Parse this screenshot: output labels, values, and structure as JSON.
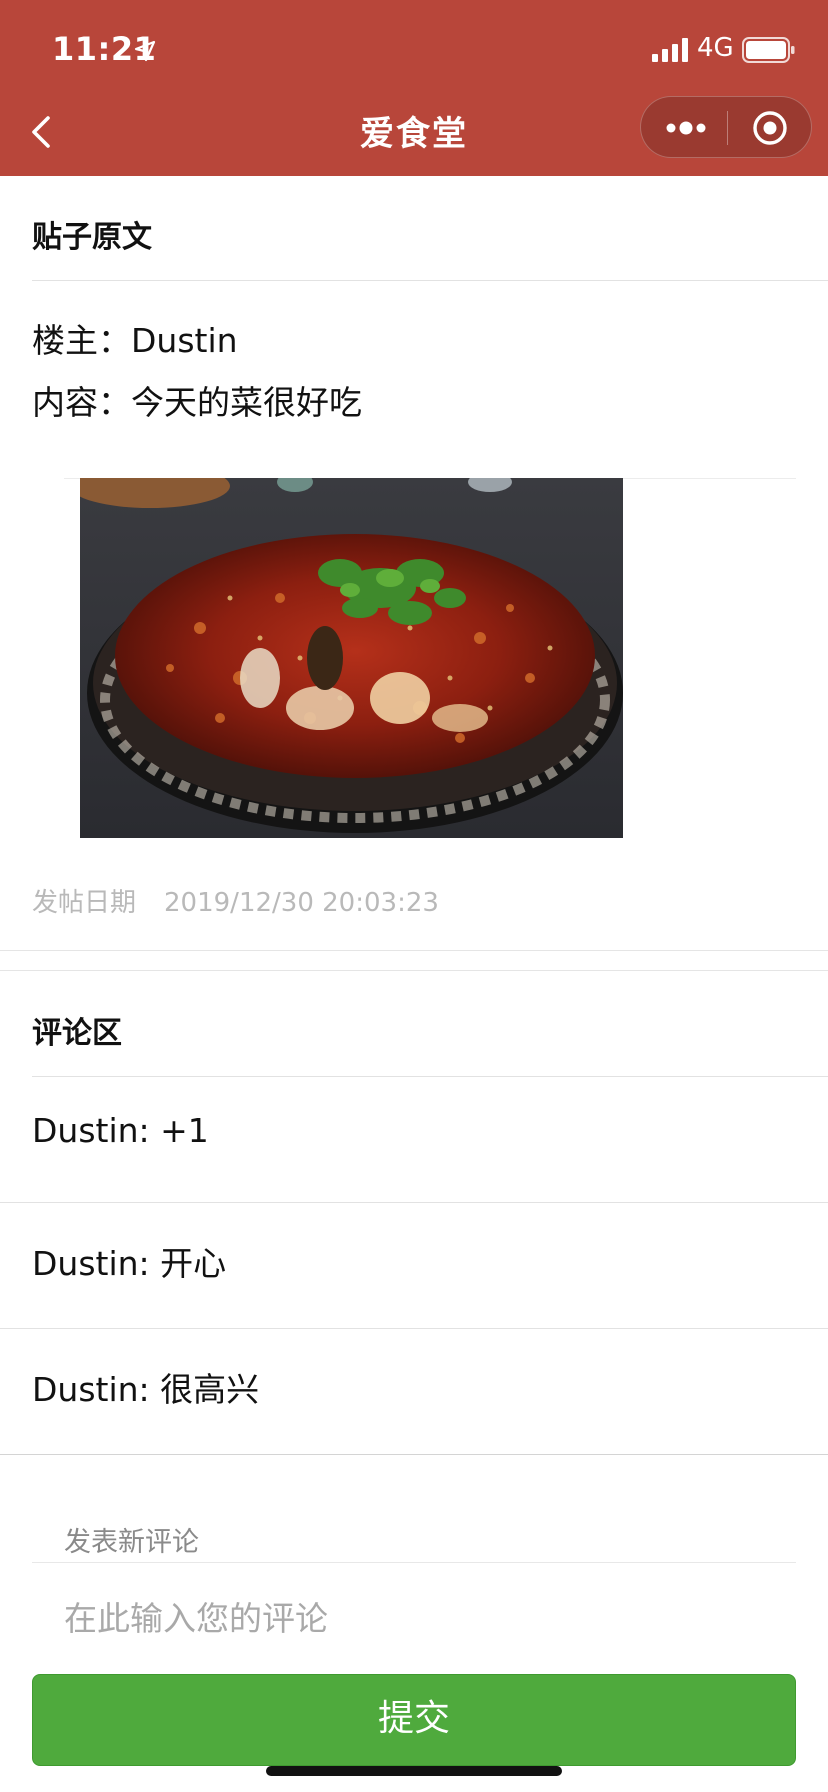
{
  "status_bar": {
    "time": "11:21",
    "network": "4G"
  },
  "nav": {
    "title": "爱食堂"
  },
  "post": {
    "section_title": "贴子原文",
    "author_label": "楼主：",
    "author": "Dustin",
    "content_label": "内容：",
    "content": "今天的菜很好吃",
    "date_label": "发帖日期",
    "date": "2019/12/30 20:03:23"
  },
  "comments": {
    "section_title": "评论区",
    "items": [
      {
        "text": "Dustin: +1"
      },
      {
        "text": "Dustin: 开心"
      },
      {
        "text": "Dustin: 很高兴"
      }
    ]
  },
  "new_comment": {
    "label": "发表新评论",
    "placeholder": "在此输入您的评论",
    "submit_label": "提交"
  },
  "colors": {
    "header_bg": "#b8463a",
    "submit_bg": "#4faa3d",
    "muted_text": "#b9b9b9"
  },
  "icons": {
    "back": "chevron-left-icon",
    "more": "more-dots-icon",
    "close": "target-close-icon",
    "location": "location-arrow-icon",
    "signal": "signal-bars-icon",
    "battery": "battery-icon"
  }
}
